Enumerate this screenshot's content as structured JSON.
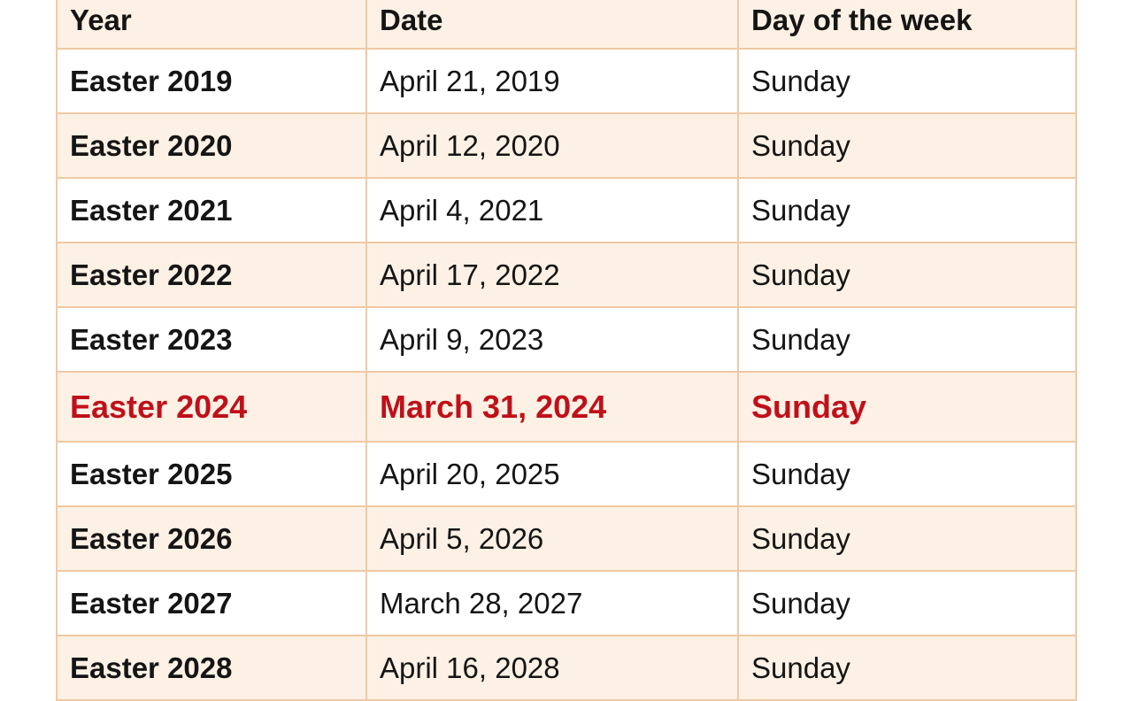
{
  "table": {
    "headers": [
      "Year",
      "Date",
      "Day of the week"
    ],
    "highlight_color": "#c0101a",
    "rows": [
      {
        "year": "Easter 2019",
        "date": "April 21, 2019",
        "day": "Sunday"
      },
      {
        "year": "Easter 2020",
        "date": "April 12, 2020",
        "day": "Sunday"
      },
      {
        "year": "Easter 2021",
        "date": "April 4, 2021",
        "day": "Sunday"
      },
      {
        "year": "Easter 2022",
        "date": "April 17, 2022",
        "day": "Sunday"
      },
      {
        "year": "Easter 2023",
        "date": "April 9, 2023",
        "day": "Sunday"
      },
      {
        "year": "Easter 2024",
        "date": "March 31, 2024",
        "day": "Sunday",
        "highlighted": true
      },
      {
        "year": "Easter 2025",
        "date": "April 20, 2025",
        "day": "Sunday"
      },
      {
        "year": "Easter 2026",
        "date": "April 5, 2026",
        "day": "Sunday"
      },
      {
        "year": "Easter 2027",
        "date": "March 28, 2027",
        "day": "Sunday"
      },
      {
        "year": "Easter 2028",
        "date": "April 16, 2028",
        "day": "Sunday"
      }
    ]
  }
}
